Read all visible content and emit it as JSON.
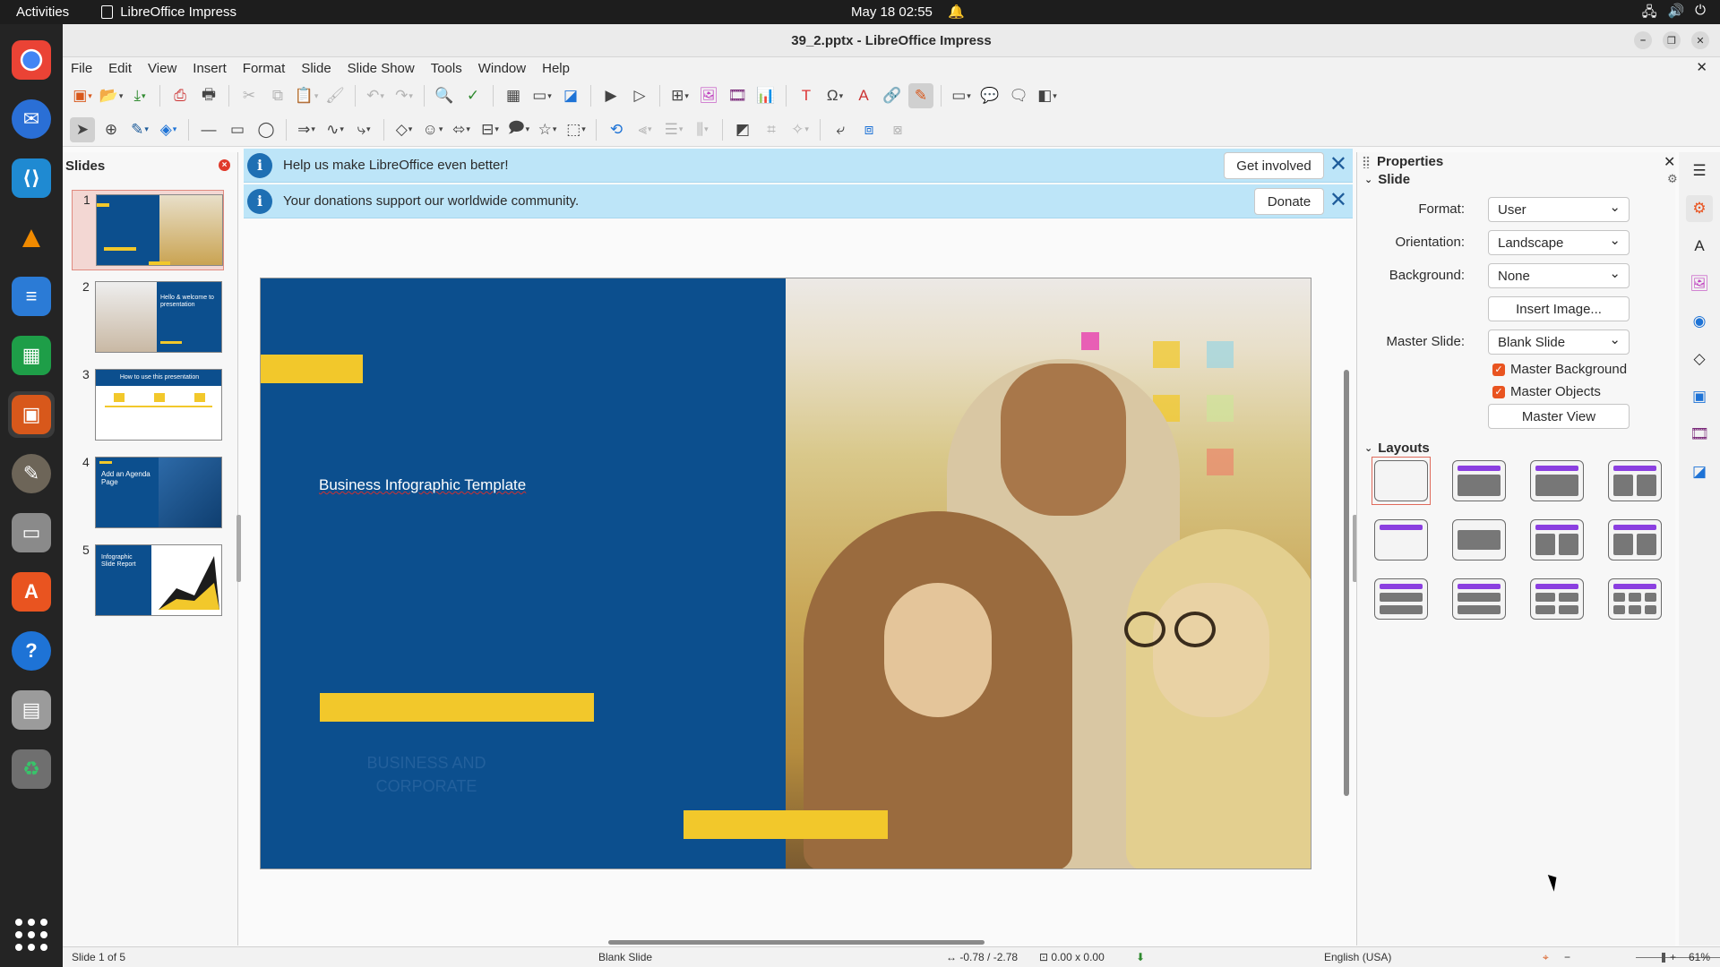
{
  "topbar": {
    "activities": "Activities",
    "app_name": "LibreOffice Impress",
    "clock": "May 18  02:55"
  },
  "window": {
    "title": "39_2.pptx - LibreOffice Impress"
  },
  "menu": [
    "File",
    "Edit",
    "View",
    "Insert",
    "Format",
    "Slide",
    "Slide Show",
    "Tools",
    "Window",
    "Help"
  ],
  "slides_pane": {
    "title": "Slides",
    "slides": [
      {
        "num": "1",
        "title": "Business Infographic Template"
      },
      {
        "num": "2",
        "title": "Hello & welcome to presentation"
      },
      {
        "num": "3",
        "title": "How to use this presentation"
      },
      {
        "num": "4",
        "title": "Add an Agenda Page"
      },
      {
        "num": "5",
        "title": "Infographic Slide Report"
      }
    ]
  },
  "infobars": [
    {
      "message": "Help us make LibreOffice even better!",
      "button": "Get involved"
    },
    {
      "message": "Your donations support our worldwide community.",
      "button": "Donate"
    }
  ],
  "slide": {
    "title": "Business Infographic Template",
    "ghost_text_1": "BUSINESS AND",
    "ghost_text_2": "CORPORATE"
  },
  "properties": {
    "title": "Properties",
    "section_slide": "Slide",
    "format_label": "Format:",
    "format_value": "User",
    "orientation_label": "Orientation:",
    "orientation_value": "Landscape",
    "background_label": "Background:",
    "background_value": "None",
    "insert_image": "Insert Image...",
    "master_slide_label": "Master Slide:",
    "master_slide_value": "Blank Slide",
    "master_background": "Master Background",
    "master_objects": "Master Objects",
    "master_view": "Master View",
    "section_layouts": "Layouts"
  },
  "status": {
    "slide_pos": "Slide 1 of 5",
    "master": "Blank Slide",
    "position": "-0.78 / -2.78",
    "size": "0.00 x 0.00",
    "language": "English (USA)",
    "zoom": "61%"
  },
  "colors": {
    "brand_blue": "#0c4f8e",
    "accent_yellow": "#f2c82b",
    "layout_title": "#8b3fe0",
    "checkbox": "#e95420"
  }
}
